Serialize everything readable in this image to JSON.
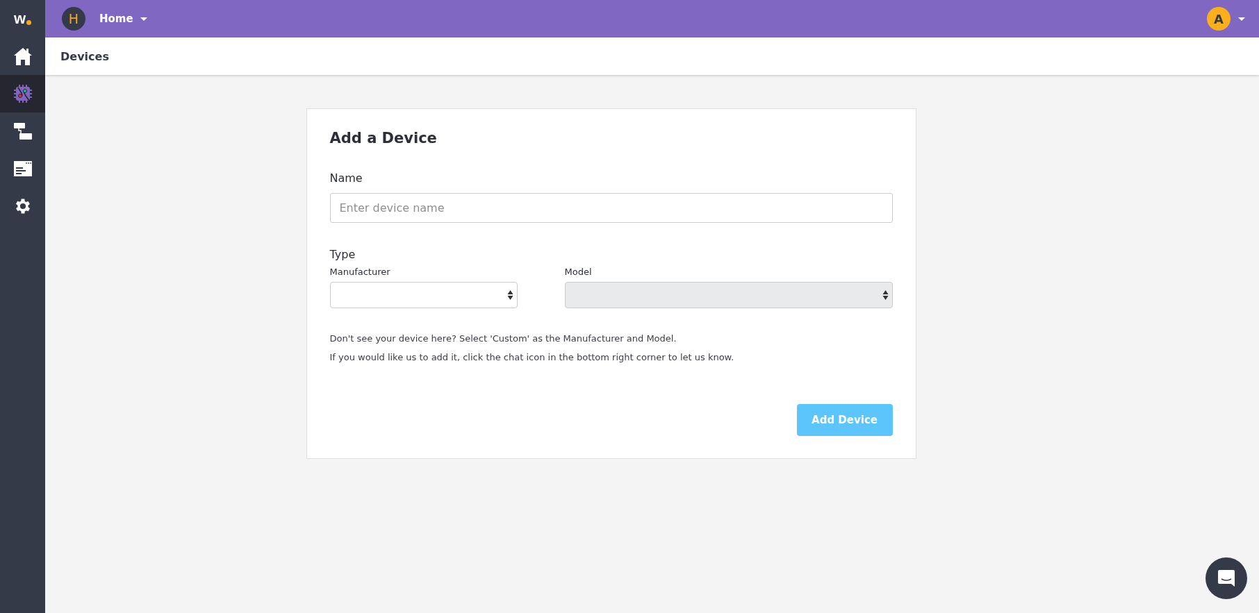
{
  "sidebar": {
    "logo": "w",
    "items": [
      {
        "kind": "home",
        "selected": false
      },
      {
        "kind": "devices",
        "selected": true
      },
      {
        "kind": "flows",
        "selected": false
      },
      {
        "kind": "logs",
        "selected": false
      },
      {
        "kind": "settings",
        "selected": false
      }
    ]
  },
  "topbar": {
    "home_initial": "H",
    "home_label": "Home",
    "user_initial": "A"
  },
  "page_title": "Devices",
  "form": {
    "title": "Add a Device",
    "name_label": "Name",
    "name_placeholder": "Enter device name",
    "type_label": "Type",
    "selects": [
      {
        "label": "Manufacturer",
        "disabled": false
      },
      {
        "label": "Model",
        "disabled": true
      }
    ],
    "help": [
      "Don't see your device here? Select 'Custom' as the Manufacturer and Model.",
      "If you would like us to add it, click the chat icon in the bottom right corner to let us know."
    ],
    "submit": {
      "label": "Add Device",
      "disabled": true
    }
  }
}
